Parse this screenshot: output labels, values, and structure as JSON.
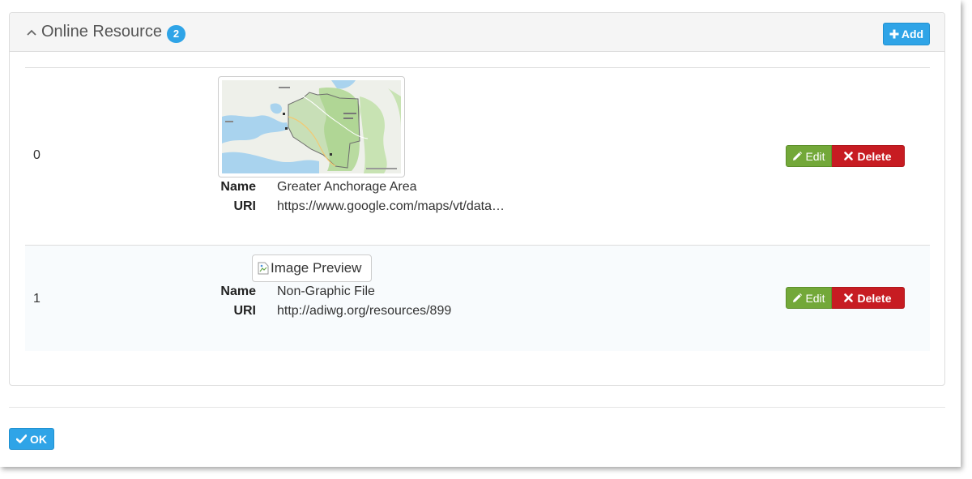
{
  "panel": {
    "title": "Online Resource",
    "count": "2",
    "add_label": "Add"
  },
  "resources": [
    {
      "index": "0",
      "name_label": "Name",
      "name": "Greater Anchorage Area",
      "uri_label": "URI",
      "uri": "https://www.google.com/maps/vt/data…",
      "edit_label": "Edit",
      "delete_label": "Delete"
    },
    {
      "index": "1",
      "preview_alt": "Image Preview",
      "name_label": "Name",
      "name": "Non-Graphic File",
      "uri_label": "URI",
      "uri": "http://adiwg.org/resources/899",
      "edit_label": "Edit",
      "delete_label": "Delete"
    }
  ],
  "footer": {
    "ok_label": "OK"
  },
  "icons": {
    "collapse": "chevron-up-icon",
    "add": "plus-icon",
    "edit": "pencil-icon",
    "delete": "times-icon",
    "ok": "check-icon",
    "broken_image": "broken-image-icon"
  },
  "colors": {
    "primary": "#2fa4e7",
    "success": "#73a839",
    "danger": "#c71c22",
    "heading_bg": "#f5f5f5"
  }
}
